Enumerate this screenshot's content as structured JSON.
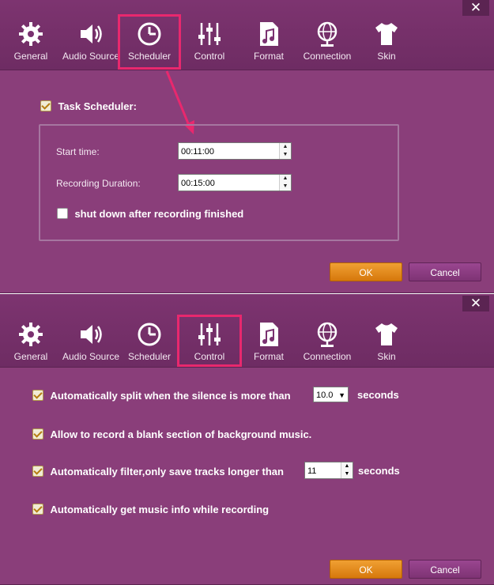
{
  "tabs": [
    {
      "label": "General",
      "icon": "gear-icon"
    },
    {
      "label": "Audio Source",
      "icon": "speaker-icon"
    },
    {
      "label": "Scheduler",
      "icon": "clock-icon"
    },
    {
      "label": "Control",
      "icon": "sliders-icon"
    },
    {
      "label": "Format",
      "icon": "music-file-icon"
    },
    {
      "label": "Connection",
      "icon": "globe-icon"
    },
    {
      "label": "Skin",
      "icon": "tshirt-icon"
    }
  ],
  "close_symbol": "✕",
  "scheduler": {
    "task_scheduler_label": "Task Scheduler:",
    "task_scheduler_checked": true,
    "start_time_label": "Start time:",
    "start_time_value": "00:11:00",
    "duration_label": "Recording Duration:",
    "duration_value": "00:15:00",
    "shutdown_label": "shut down after recording finished",
    "shutdown_checked": false,
    "ok_label": "OK",
    "cancel_label": "Cancel"
  },
  "control": {
    "split_label": "Automatically split when the silence is more than",
    "split_value": "10.0",
    "split_unit": "seconds",
    "blank_label": "Allow to record a blank section of background music.",
    "filter_label": "Automatically filter,only save tracks longer than",
    "filter_value": "11",
    "filter_unit": "seconds",
    "musicinfo_label": "Automatically get music info while recording",
    "ok_label": "OK",
    "cancel_label": "Cancel"
  },
  "colors": {
    "panel_bg": "#8a3e7a",
    "highlight": "#e8286e",
    "ok_button": "#e08a1c"
  }
}
